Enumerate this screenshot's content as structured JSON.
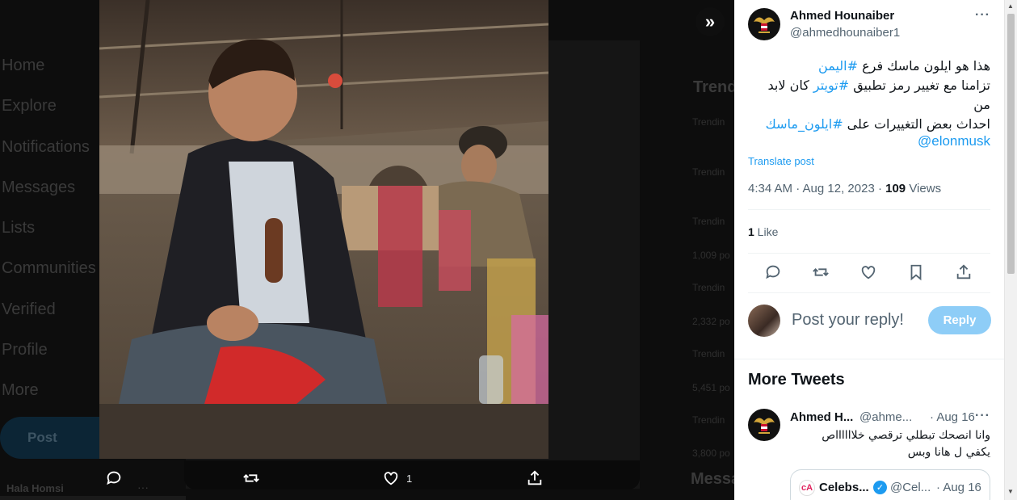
{
  "background": {
    "nav_items": [
      "Home",
      "Explore",
      "Notifications",
      "Messages",
      "Lists",
      "Communities",
      "Verified",
      "Profile",
      "More"
    ],
    "post_button": "Post",
    "user_name": "Hala Homsi",
    "trends_title": "Trend",
    "trend_lines": [
      "Trendin",
      "Trendin",
      "Trendin",
      "1,009 po",
      "Trendin",
      "2,332 po",
      "Trendin",
      "5,451 po",
      "Trendin",
      "3,800 po"
    ],
    "messages_title": "Messa"
  },
  "media": {
    "like_count": "1",
    "icons": [
      "reply-icon",
      "retweet-icon",
      "like-icon",
      "share-icon"
    ]
  },
  "tweet": {
    "author_name": "Ahmed Hounaiber",
    "author_handle": "@ahmedhounaiber1",
    "text_line1_prefix": "هذا هو ايلون ماسك فرع ",
    "text_line1_tag": "#اليمن",
    "text_line2_prefix": "تزامنا مع تغيير رمز تطبيق ",
    "text_line2_tag": "#تويتر",
    "text_line2_suffix": " كان لابد من",
    "text_line3_prefix": "احداث بعض التغييرات على ",
    "text_line3_tag": "#ايلون_ماسك",
    "mention": "@elonmusk",
    "translate_label": "Translate post",
    "time": "4:34 AM · Aug 12, 2023 · ",
    "views_count": "109",
    "views_label": " Views",
    "likes_count": "1",
    "likes_label": " Like"
  },
  "reply": {
    "placeholder": "Post your reply!",
    "button": "Reply"
  },
  "more_tweets": {
    "title": "More Tweets",
    "item": {
      "name": "Ahmed H...",
      "handle": "@ahme...",
      "date": "· Aug 16",
      "text_line1": "وانا انصحك تبطلي ترقصي خلااااااص",
      "text_line2": "يكفي ل هانا وبس",
      "quote_name": "Celebs...",
      "quote_handle": "@Cel...",
      "quote_date": "· Aug 16"
    }
  },
  "colors": {
    "accent": "#1d9bf0",
    "reply_button": "#8ecdf7",
    "secondary_text": "#536471"
  }
}
